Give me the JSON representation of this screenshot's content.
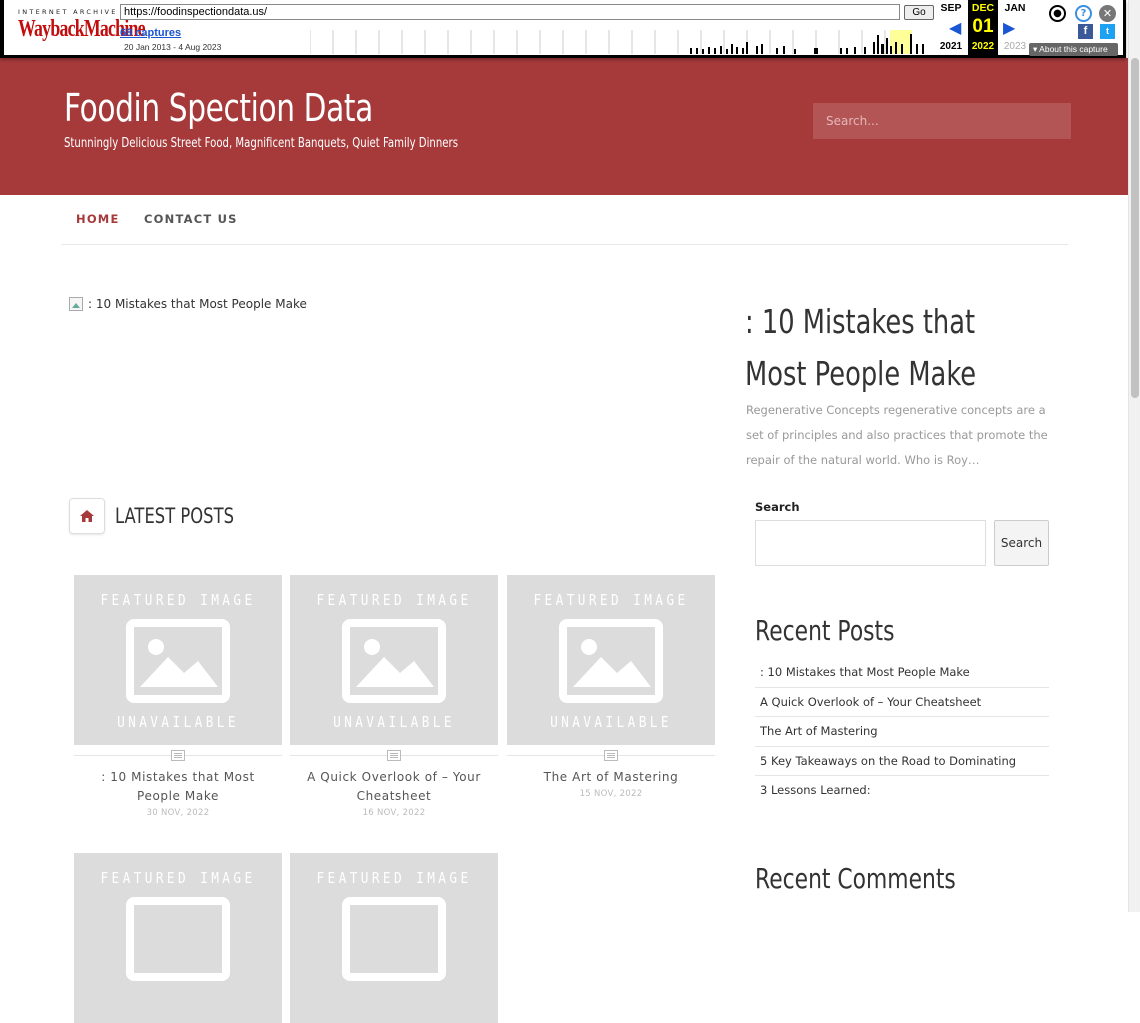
{
  "wayback": {
    "logo_top": "INTERNET ARCHIVE",
    "logo_main": "WaybackMachine",
    "url": "https://foodinspectiondata.us/",
    "go_label": "Go",
    "captures": "68 captures",
    "date_range": "20 Jan 2013 - 4 Aug 2023",
    "prev_month": "SEP",
    "cur_month": "DEC",
    "next_month": "JAN",
    "cur_day": "01",
    "prev_year": "2021",
    "cur_year": "2022",
    "next_year": "2023",
    "about": "About this capture"
  },
  "site": {
    "title": "Foodin Spection Data",
    "tagline": "Stunningly Delicious Street Food, Magnificent Banquets, Quiet Family Dinners",
    "search_placeholder": "Search..."
  },
  "nav": {
    "items": [
      "HOME",
      "CONTACT US"
    ]
  },
  "featured": {
    "image_alt": ": 10 Mistakes that Most People Make",
    "title": ": 10 Mistakes that Most People Make",
    "excerpt": "Regenerative Concepts regenerative concepts are a set of principles and also practices that promote the repair of the natural world. Who is Roy…"
  },
  "latest": {
    "heading": "LATEST POSTS",
    "placeholder_top": "FEATURED IMAGE",
    "placeholder_bottom": "UNAVAILABLE",
    "posts": [
      {
        "title": ": 10 Mistakes that Most People Make",
        "date": "30 NOV, 2022"
      },
      {
        "title": "A Quick Overlook of – Your Cheatsheet",
        "date": "16 NOV, 2022"
      },
      {
        "title": "The Art of Mastering",
        "date": "15 NOV, 2022"
      }
    ]
  },
  "sidebar": {
    "search_label": "Search",
    "search_button": "Search",
    "recent_posts_title": "Recent Posts",
    "recent_posts": [
      ": 10 Mistakes that Most People Make",
      "A Quick Overlook of – Your Cheatsheet",
      "The Art of Mastering",
      "5 Key Takeaways on the Road to Dominating",
      "3 Lessons Learned:"
    ],
    "recent_comments_title": "Recent Comments"
  },
  "colors": {
    "brand": "#a63a3b",
    "wayback_red": "#c10d0d",
    "wayback_blue": "#1a55d3"
  }
}
